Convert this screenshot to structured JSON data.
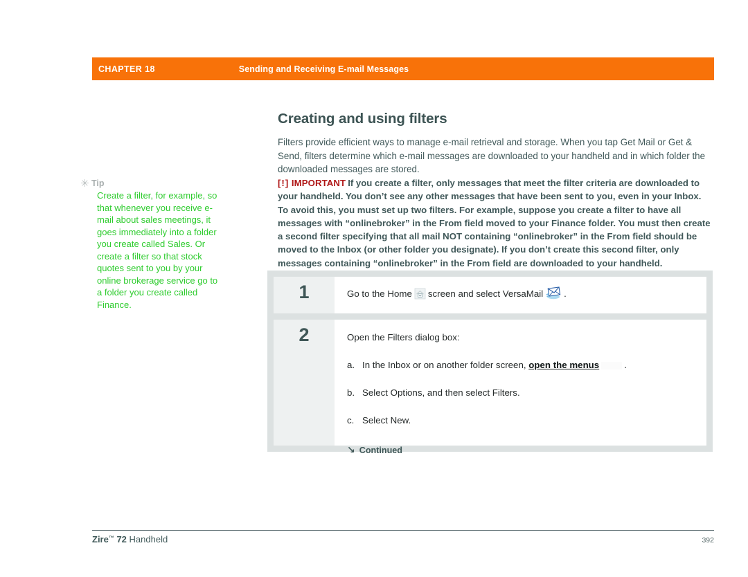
{
  "header": {
    "chapter_label": "CHAPTER 18",
    "section_title": "Sending and Receiving E-mail Messages",
    "bar_color": "#f87209"
  },
  "tip": {
    "icon": "asterisk-icon",
    "title": "Tip",
    "body": "Create a filter, for example, so that whenever you receive e-mail about sales meetings, it goes immediately into a folder you create called Sales. Or create a filter so that stock quotes sent to you by your online brokerage service go to a folder you create called Finance.",
    "text_color": "#2fcc2f",
    "title_color": "#a8aeae"
  },
  "main": {
    "title": "Creating and using filters",
    "intro": "Filters provide efficient ways to manage e-mail retrieval and storage. When you tap Get Mail or Get & Send, filters determine which e-mail messages are downloaded to your handheld and in which folder the downloaded messages are stored."
  },
  "important": {
    "bracket_open": "[",
    "bang": "!",
    "bracket_close": "]",
    "label": "IMPORTANT",
    "label_color": "#b01818",
    "body": "If you create a filter, only messages that meet the filter criteria are downloaded to your handheld. You don’t see any other messages that have been sent to you, even in your Inbox. To avoid this, you must set up two filters. For example, suppose you create a filter to have all messages with “onlinebroker” in the From field moved to your Finance folder. You must then create a second filter specifying that all mail NOT containing “onlinebroker” in the From field should be moved to the Inbox (or other folder you designate). If you don’t create this second filter, only messages containing “onlinebroker” in the From field are downloaded to your handheld."
  },
  "steps": [
    {
      "number": "1",
      "text_before_home": "Go to the Home",
      "home_icon": "home-screen-icon",
      "text_middle": "screen and select VersaMail",
      "mail_icon": "versamail-envelope-icon",
      "text_after": "."
    },
    {
      "number": "2",
      "lead": "Open the Filters dialog box:",
      "substeps": [
        {
          "marker": "a.",
          "text_before_link": "In the Inbox or on another folder screen,",
          "link_text": "open the menus",
          "trailing_icon": "menu-key-icon",
          "text_after": "."
        },
        {
          "marker": "b.",
          "text": "Select Options, and then select Filters."
        },
        {
          "marker": "c.",
          "text": "Select New."
        }
      ],
      "continued_arrow": "arrow-down-right-icon",
      "continued_label": "Continued"
    }
  ],
  "footer": {
    "brand": "Zire",
    "trademark": "™",
    "model": " 72",
    "product": " Handheld",
    "page_number": "392"
  }
}
